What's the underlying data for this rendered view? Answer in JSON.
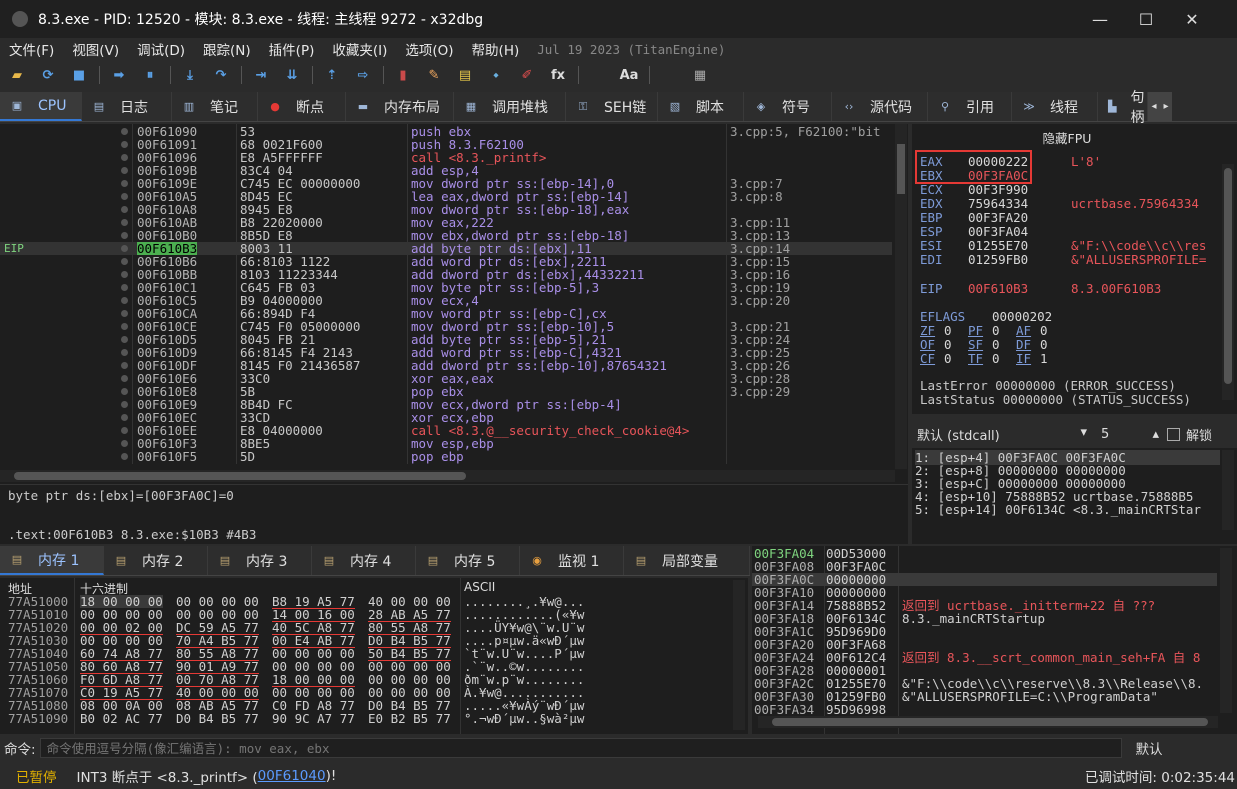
{
  "title": "8.3.exe - PID: 12520 - 模块: 8.3.exe - 线程: 主线程 9272 - x32dbg",
  "window_controls": [
    "—",
    "☐",
    "✕"
  ],
  "menu": [
    "文件(F)",
    "视图(V)",
    "调试(D)",
    "跟踪(N)",
    "插件(P)",
    "收藏夹(I)",
    "选项(O)",
    "帮助(H)"
  ],
  "build": "Jul 19 2023 (TitanEngine)",
  "toolbar": [
    "folder-open-icon",
    "restart-icon",
    "stop-icon",
    "sep",
    "run-icon",
    "pause-icon",
    "sep",
    "step-into-icon",
    "step-over-icon",
    "sep",
    "trace-into-icon",
    "trace-over-icon",
    "sep",
    "execute-till-return-icon",
    "run-to-user-code-icon",
    "sep",
    "patch-icon",
    "comment-icon",
    "label-icon",
    "bookmark-icon",
    "function-icon",
    "hash-icon",
    "sep",
    "font-icon",
    "memory-map-icon",
    "sep",
    "calculator-icon",
    "globe-icon"
  ],
  "toolbar_glyphs": [
    "▰",
    "⟳",
    "■",
    "",
    "➡",
    "⏸",
    "",
    "⤓",
    "↷",
    "",
    "⇥",
    "⇊",
    "",
    "⇡",
    "⇨",
    "",
    "▮",
    "✎",
    "▤",
    "⬩",
    "✐",
    "fx",
    "#",
    "",
    "Aa",
    "⤓",
    "",
    "▦",
    "●"
  ],
  "tabs": [
    {
      "label": "CPU",
      "icon": "cpu-icon",
      "glyph": "▣"
    },
    {
      "label": "日志",
      "icon": "log-icon",
      "glyph": "▤"
    },
    {
      "label": "笔记",
      "icon": "notes-icon",
      "glyph": "▥"
    },
    {
      "label": "断点",
      "icon": "breakpoint-icon",
      "glyph": "●"
    },
    {
      "label": "内存布局",
      "icon": "memory-layout-icon",
      "glyph": "▬"
    },
    {
      "label": "调用堆栈",
      "icon": "callstack-icon",
      "glyph": "▦"
    },
    {
      "label": "SEH链",
      "icon": "seh-icon",
      "glyph": "⚿"
    },
    {
      "label": "脚本",
      "icon": "script-icon",
      "glyph": "▧"
    },
    {
      "label": "符号",
      "icon": "symbols-icon",
      "glyph": "◈"
    },
    {
      "label": "源代码",
      "icon": "source-icon",
      "glyph": "‹›"
    },
    {
      "label": "引用",
      "icon": "references-icon",
      "glyph": "⚲"
    },
    {
      "label": "线程",
      "icon": "threads-icon",
      "glyph": "≫"
    },
    {
      "label": "句柄",
      "icon": "handles-icon",
      "glyph": "▙"
    }
  ],
  "disasm": [
    {
      "a": "00F61090",
      "b": "53",
      "i": "push ebx",
      "c": "3.cpp:5, F62100:\"bit"
    },
    {
      "a": "00F61091",
      "b": "68 0021F600",
      "i": "push 8.3.F62100",
      "c": ""
    },
    {
      "a": "00F61096",
      "b": "E8 A5FFFFFF",
      "i": "call <8.3._printf>",
      "c": "",
      "red": true
    },
    {
      "a": "00F6109B",
      "b": "83C4 04",
      "i": "add esp,4",
      "c": ""
    },
    {
      "a": "00F6109E",
      "b": "C745 EC 00000000",
      "i": "mov dword ptr ss:[ebp-14],0",
      "c": "3.cpp:7"
    },
    {
      "a": "00F610A5",
      "b": "8D45 EC",
      "i": "lea eax,dword ptr ss:[ebp-14]",
      "c": "3.cpp:8"
    },
    {
      "a": "00F610A8",
      "b": "8945 E8",
      "i": "mov dword ptr ss:[ebp-18],eax",
      "c": ""
    },
    {
      "a": "00F610AB",
      "b": "B8 22020000",
      "i": "mov eax,222",
      "c": "3.cpp:11"
    },
    {
      "a": "00F610B0",
      "b": "8B5D E8",
      "i": "mov ebx,dword ptr ss:[ebp-18]",
      "c": "3.cpp:13"
    },
    {
      "a": "00F610B3",
      "b": "8003 11",
      "i": "add byte ptr ds:[ebx],11",
      "c": "3.cpp:14",
      "cur": true
    },
    {
      "a": "00F610B6",
      "b": "66:8103 1122",
      "i": "add word ptr ds:[ebx],2211",
      "c": "3.cpp:15"
    },
    {
      "a": "00F610BB",
      "b": "8103 11223344",
      "i": "add dword ptr ds:[ebx],44332211",
      "c": "3.cpp:16"
    },
    {
      "a": "00F610C1",
      "b": "C645 FB 03",
      "i": "mov byte ptr ss:[ebp-5],3",
      "c": "3.cpp:19"
    },
    {
      "a": "00F610C5",
      "b": "B9 04000000",
      "i": "mov ecx,4",
      "c": "3.cpp:20"
    },
    {
      "a": "00F610CA",
      "b": "66:894D F4",
      "i": "mov word ptr ss:[ebp-C],cx",
      "c": ""
    },
    {
      "a": "00F610CE",
      "b": "C745 F0 05000000",
      "i": "mov dword ptr ss:[ebp-10],5",
      "c": "3.cpp:21"
    },
    {
      "a": "00F610D5",
      "b": "8045 FB 21",
      "i": "add byte ptr ss:[ebp-5],21",
      "c": "3.cpp:24"
    },
    {
      "a": "00F610D9",
      "b": "66:8145 F4 2143",
      "i": "add word ptr ss:[ebp-C],4321",
      "c": "3.cpp:25"
    },
    {
      "a": "00F610DF",
      "b": "8145 F0 21436587",
      "i": "add dword ptr ss:[ebp-10],87654321",
      "c": "3.cpp:26"
    },
    {
      "a": "00F610E6",
      "b": "33C0",
      "i": "xor eax,eax",
      "c": "3.cpp:28"
    },
    {
      "a": "00F610E8",
      "b": "5B",
      "i": "pop ebx",
      "c": "3.cpp:29"
    },
    {
      "a": "00F610E9",
      "b": "8B4D FC",
      "i": "mov ecx,dword ptr ss:[ebp-4]",
      "c": ""
    },
    {
      "a": "00F610EC",
      "b": "33CD",
      "i": "xor ecx,ebp",
      "c": ""
    },
    {
      "a": "00F610EE",
      "b": "E8 04000000",
      "i": "call <8.3.@__security_check_cookie@4>",
      "c": "",
      "red": true
    },
    {
      "a": "00F610F3",
      "b": "8BE5",
      "i": "mov esp,ebp",
      "c": ""
    },
    {
      "a": "00F610F5",
      "b": "5D",
      "i": "pop ebp",
      "c": ""
    }
  ],
  "eip_label": "EIP",
  "info": {
    "line1": "byte ptr ds:[ebx]=[00F3FA0C]=0",
    "line2": ".text:00F610B3 8.3.exe:$10B3 #4B3"
  },
  "regs": {
    "header": "隐藏FPU",
    "items": [
      {
        "n": "EAX",
        "v": "00000222",
        "c": "L'8'"
      },
      {
        "n": "EBX",
        "v": "00F3FA0C",
        "c": ""
      },
      {
        "n": "ECX",
        "v": "00F3F990",
        "c": ""
      },
      {
        "n": "EDX",
        "v": "75964334",
        "c": "ucrtbase.75964334"
      },
      {
        "n": "EBP",
        "v": "00F3FA20",
        "c": ""
      },
      {
        "n": "ESP",
        "v": "00F3FA04",
        "c": ""
      },
      {
        "n": "ESI",
        "v": "01255E70",
        "c": "&\"F:\\\\code\\\\c\\\\res"
      },
      {
        "n": "EDI",
        "v": "01259FB0",
        "c": "&\"ALLUSERSPROFILE="
      }
    ],
    "eip": {
      "n": "EIP",
      "v": "00F610B3",
      "c": "8.3.00F610B3"
    },
    "eflags": {
      "n": "EFLAGS",
      "v": "00000202"
    },
    "flags": [
      [
        "ZF",
        "0",
        "PF",
        "0",
        "AF",
        "0"
      ],
      [
        "OF",
        "0",
        "SF",
        "0",
        "DF",
        "0"
      ],
      [
        "CF",
        "0",
        "TF",
        "0",
        "IF",
        "1"
      ]
    ],
    "lasterror": "LastError  00000000 (ERROR_SUCCESS)",
    "laststatus": "LastStatus 00000000 (STATUS_SUCCESS)"
  },
  "stackhdr": {
    "conv": "默认 (stdcall)",
    "count": "5",
    "unlock": "解锁"
  },
  "stackargs": [
    "1: [esp+4] 00F3FA0C 00F3FA0C",
    "2: [esp+8] 00000000 00000000",
    "3: [esp+C] 00000000 00000000",
    "4: [esp+10] 75888B52 ucrtbase.75888B5",
    "5: [esp+14] 00F6134C <8.3._mainCRTStar"
  ],
  "btabs": [
    {
      "label": "内存 1",
      "icon": "dump-icon"
    },
    {
      "label": "内存 2",
      "icon": "dump-icon"
    },
    {
      "label": "内存 3",
      "icon": "dump-icon"
    },
    {
      "label": "内存 4",
      "icon": "dump-icon"
    },
    {
      "label": "内存 5",
      "icon": "dump-icon"
    },
    {
      "label": "监视 1",
      "icon": "watch-icon"
    },
    {
      "label": "局部变量",
      "icon": "locals-icon"
    }
  ],
  "dump": {
    "headers": [
      "地址",
      "十六进制",
      "ASCII"
    ],
    "rows": [
      {
        "a": "77A51000",
        "h": [
          "18 00 00 00",
          "00 00 00 00",
          "B8 19 A5 77",
          "40 00 00 00"
        ],
        "s": "........¸.¥w@..."
      },
      {
        "a": "77A51010",
        "h": [
          "00 00 00 00",
          "00 00 00 00",
          "14 00 16 00",
          "28 AB A5 77"
        ],
        "s": "............(«¥w"
      },
      {
        "a": "77A51020",
        "h": [
          "00 00 02 00",
          "DC 59 A5 77",
          "40 5C A8 77",
          "80 55 A8 77"
        ],
        "s": "....ÜY¥w@\\¨w.U¨w"
      },
      {
        "a": "77A51030",
        "h": [
          "00 00 00 00",
          "70 A4 B5 77",
          "00 E4 AB 77",
          "D0 B4 B5 77"
        ],
        "s": "....p¤µw.ä«wÐ´µw"
      },
      {
        "a": "77A51040",
        "h": [
          "60 74 A8 77",
          "80 55 A8 77",
          "00 00 00 00",
          "50 B4 B5 77"
        ],
        "s": "`t¨w.U¨w....P´µw"
      },
      {
        "a": "77A51050",
        "h": [
          "80 60 A8 77",
          "90 01 A9 77",
          "00 00 00 00",
          "00 00 00 00"
        ],
        "s": ".`¨w..©w........"
      },
      {
        "a": "77A51060",
        "h": [
          "F0 6D A8 77",
          "00 70 A8 77",
          "18 00 00 00",
          "00 00 00 00"
        ],
        "s": "ðm¨w.p¨w........"
      },
      {
        "a": "77A51070",
        "h": [
          "C0 19 A5 77",
          "40 00 00 00",
          "00 00 00 00",
          "00 00 00 00"
        ],
        "s": "À.¥w@..........."
      },
      {
        "a": "77A51080",
        "h": [
          "08 00 0A 00",
          "08 AB A5 77",
          "C0 FD A8 77",
          "D0 B4 B5 77"
        ],
        "s": ".....«¥wÀý¨wÐ´µw"
      },
      {
        "a": "77A51090",
        "h": [
          "B0 02 AC 77",
          "D0 B4 B5 77",
          "90 9C A7 77",
          "E0 B2 B5 77"
        ],
        "s": "°.¬wÐ´µw..§wà²µw"
      }
    ]
  },
  "stack2": [
    {
      "a": "00F3FA04",
      "v": "00D53000",
      "c": "",
      "top": true
    },
    {
      "a": "00F3FA08",
      "v": "00F3FA0C",
      "c": ""
    },
    {
      "a": "00F3FA0C",
      "v": "00000000",
      "c": "",
      "sel": true
    },
    {
      "a": "00F3FA10",
      "v": "00000000",
      "c": ""
    },
    {
      "a": "00F3FA14",
      "v": "75888B52",
      "c": "返回到 ucrtbase._initterm+22 自 ???",
      "red": true
    },
    {
      "a": "00F3FA18",
      "v": "00F6134C",
      "c": "8.3._mainCRTStartup"
    },
    {
      "a": "00F3FA1C",
      "v": "95D969D0",
      "c": ""
    },
    {
      "a": "00F3FA20",
      "v": "00F3FA68",
      "c": ""
    },
    {
      "a": "00F3FA24",
      "v": "00F612C4",
      "c": "返回到 8.3.__scrt_common_main_seh+FA 自 8",
      "red": true
    },
    {
      "a": "00F3FA28",
      "v": "00000001",
      "c": ""
    },
    {
      "a": "00F3FA2C",
      "v": "01255E70",
      "c": "&\"F:\\\\code\\\\c\\\\reserve\\\\8.3\\\\Release\\\\8."
    },
    {
      "a": "00F3FA30",
      "v": "01259FB0",
      "c": "&\"ALLUSERSPROFILE=C:\\\\ProgramData\""
    },
    {
      "a": "00F3FA34",
      "v": "95D96998",
      "c": ""
    }
  ],
  "cmd": {
    "label": "命令:",
    "placeholder": "命令使用逗号分隔(像汇编语言): mov eax, ebx",
    "right": "默认"
  },
  "status": {
    "state": "已暂停",
    "msg1": "INT3 断点于 <8.3._printf> (",
    "addr": "00F61040",
    "msg2": ")!",
    "time": "已调试时间: 0:02:35:44"
  },
  "colors": {
    "accent": "#3478d4",
    "eip_green": "#4caf50",
    "red": "#e8555a",
    "paused": "#e0b000"
  }
}
